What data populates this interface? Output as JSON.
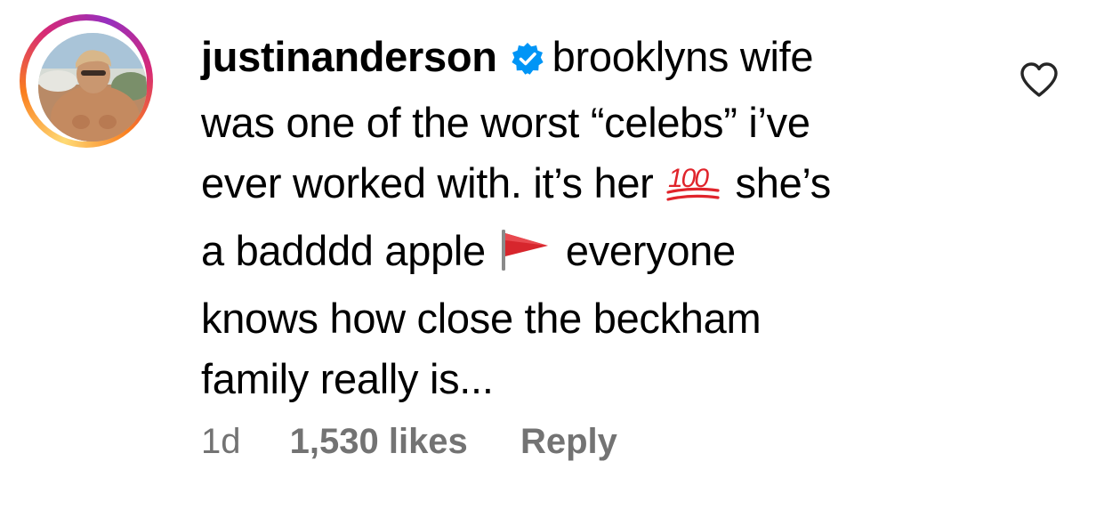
{
  "comment": {
    "username": "justinanderson",
    "verified_icon": "verified-badge-icon",
    "text_lines": [
      "brooklyns wife",
      "was one of the worst “celebs” i’ve",
      "ever worked with. it’s her",
      "she’s",
      "a badddd apple",
      "everyone",
      "knows how close the beckham",
      "family really is..."
    ],
    "emojis": {
      "hundred": "hundred-points-emoji",
      "red_flag": "red-flag-emoji"
    },
    "time": "1d",
    "likes": "1,530 likes",
    "reply": "Reply",
    "like_icon": "heart-icon"
  },
  "colors": {
    "story_ring": [
      "#feda75",
      "#fa7e1e",
      "#d62976",
      "#962fbf"
    ],
    "verified": "#0095f6",
    "meta_text": "#737373"
  }
}
